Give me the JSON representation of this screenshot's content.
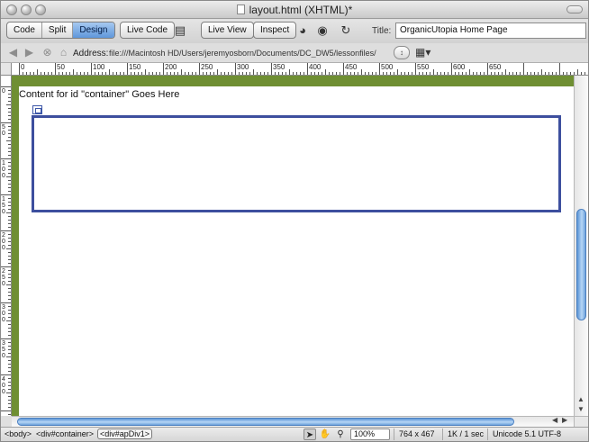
{
  "window": {
    "title": "layout.html (XHTML)*"
  },
  "toolbar": {
    "view_modes": [
      "Code",
      "Split",
      "Design"
    ],
    "active_view": "Design",
    "live_code_label": "Live Code",
    "live_view_label": "Live View",
    "inspect_label": "Inspect",
    "title_label": "Title:",
    "title_value": "OrganicUtopia Home Page"
  },
  "address": {
    "label": "Address:",
    "value": "file:///Macintosh HD/Users/jeremyosborn/Documents/DC_DW5/lessonfiles/"
  },
  "ruler": {
    "top_labels": [
      "0",
      "50",
      "100",
      "150",
      "200",
      "250",
      "300",
      "350",
      "400",
      "450",
      "500",
      "550",
      "600",
      "650"
    ],
    "left_labels": [
      "0",
      "50",
      "100",
      "150",
      "200",
      "250",
      "300",
      "350",
      "400"
    ]
  },
  "canvas": {
    "container_text": "Content for id \"container\" Goes Here"
  },
  "status": {
    "tags": [
      "<body>",
      "<div#container>",
      "<div#apDiv1>"
    ],
    "selected_tag": "<div#apDiv1>",
    "zoom": "100%",
    "window_size": "764 x 467",
    "download": "1K / 1 sec",
    "encoding": "Unicode 5.1 UTF-8"
  },
  "colors": {
    "page_background": "#6f8f33",
    "apdiv_border": "#3d4f9e",
    "active_segment": "#5f97db"
  }
}
